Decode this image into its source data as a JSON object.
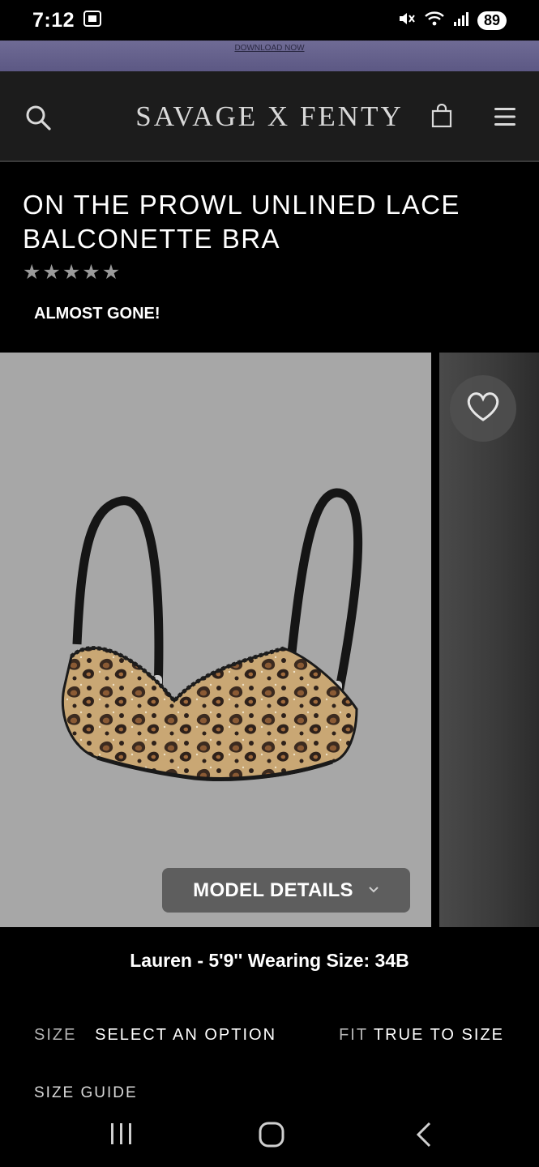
{
  "status": {
    "time": "7:12",
    "battery": "89"
  },
  "promo": {
    "link": "DOWNLOAD NOW"
  },
  "header": {
    "logo": "SAVAGE X FENTY"
  },
  "product": {
    "title": "ON THE PROWL UNLINED LACE BALCONETTE BRA",
    "rating": 0,
    "stock_message": "ALMOST GONE!"
  },
  "gallery": {
    "model_details_label": "MODEL DETAILS",
    "model_caption": "Lauren - 5'9'' Wearing Size: 34B"
  },
  "size": {
    "label": "SIZE",
    "value": "SELECT AN OPTION",
    "fit_label": "FIT",
    "fit_value": "TRUE TO SIZE",
    "guide": "SIZE GUIDE"
  },
  "icons": {
    "search": "search-icon",
    "bag": "shopping-bag-icon",
    "menu": "hamburger-menu-icon",
    "favorite": "heart-icon",
    "chevron": "chevron-down-icon"
  },
  "colors": {
    "header_bg": "#1c1c1c",
    "promo_bg": "#6a6690",
    "image_bg": "#a7a7a7",
    "button_bg": "#5e5e5e"
  }
}
